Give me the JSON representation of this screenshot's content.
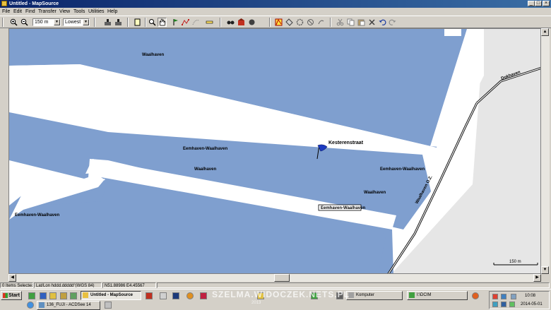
{
  "window": {
    "title": "Untitled - MapSource"
  },
  "menu": [
    "File",
    "Edit",
    "Find",
    "Transfer",
    "View",
    "Tools",
    "Utilities",
    "Help"
  ],
  "toolbar": {
    "zoom_value": "150 m",
    "detail_value": "Lowest"
  },
  "map": {
    "labels": {
      "waalhaven_top": "Waalhaven",
      "eemhaven_mid": "Eemhaven-Waalhaven",
      "waalhaven_mid": "Waalhaven",
      "eemhaven_left": "Eemhaven-Waalhaven",
      "eemhaven_right": "Eemhaven-Waalhaven",
      "waalhaven_right": "Waalhaven",
      "eemhaven_boxed": "Eemhaven-Waalhaven",
      "road_dokhaven": "Dokhaven",
      "road_waalhaven": "Waalhaven O.Z.",
      "waypoint": "Kesterenstraat"
    },
    "scale_label": "150 m",
    "colors": {
      "water": "#7f9fcf",
      "land": "#ffffff",
      "urban": "#e6e6e6",
      "road": "#000000"
    }
  },
  "status": {
    "items": "0 Items Selected",
    "format": "Lat/Lon hddd.ddddd°(WGS 84)",
    "coords": "N51.88986 E4.45567"
  },
  "taskbar": {
    "start": "Start",
    "tasks": [
      "Untitled - MapSource",
      "Komputer",
      "I:\\DCIM",
      "136_FUJI - ACDSee 14"
    ],
    "time": "10:08",
    "date": "2014-05-01",
    "watermark": "SZELMA.WIDOCZEK.NETS.PL",
    "watermark_year": "2013"
  }
}
